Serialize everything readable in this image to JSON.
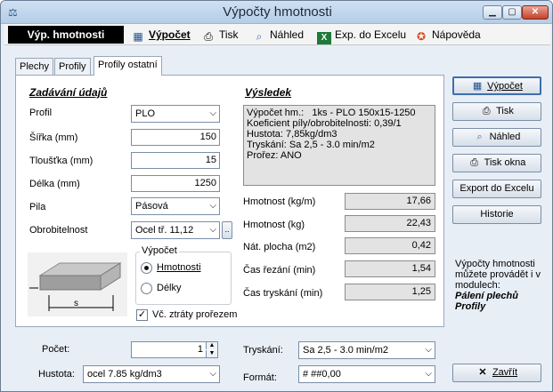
{
  "window": {
    "title": "Výpočty hmotnosti"
  },
  "menu": {
    "active": "Výp. hmotnosti",
    "items": [
      {
        "label": "Výpočet",
        "icon": "calculator-icon"
      },
      {
        "label": "Tisk",
        "icon": "printer-icon"
      },
      {
        "label": "Náhled",
        "icon": "preview-icon"
      },
      {
        "label": "Exp. do Excelu",
        "icon": "excel-icon"
      },
      {
        "label": "Nápověda",
        "icon": "help-lifebuoy-icon"
      }
    ]
  },
  "tabs": [
    "Plechy",
    "Profily",
    "Profily ostatní"
  ],
  "input_section": {
    "title": "Zadávání údajů",
    "profil_label": "Profil",
    "profil_value": "PLO",
    "sirka_label": "Šířka (mm)",
    "sirka_value": "150",
    "tloustka_label": "Tloušťka (mm)",
    "tloustka_value": "15",
    "delka_label": "Délka (mm)",
    "delka_value": "1250",
    "pila_label": "Pila",
    "pila_value": "Pásová",
    "obrobitelnost_label": "Obrobitelnost",
    "obrobitelnost_value": "Ocel tř. 11,12",
    "obrobitelnost_btn": "..",
    "diagram_label": "s",
    "vypocet_group": "Výpočet",
    "radio_hmotnosti": "Hmotnosti",
    "radio_delky": "Délky",
    "check_ztraty": "Vč. ztráty prořezem"
  },
  "result_section": {
    "title": "Výsledek",
    "text_lines": [
      "Výpočet hm.:   1ks - PLO 150x15-1250",
      "Koeficient píly/obrobitelnosti: 0,39/1",
      "Hustota: 7,85kg/dm3",
      "Tryskání: Sa 2,5 - 3.0 min/m2",
      "Prořez: ANO"
    ],
    "rows": [
      {
        "label": "Hmotnost (kg/m)",
        "value": "17,66"
      },
      {
        "label": "Hmotnost (kg)",
        "value": "22,43"
      },
      {
        "label": "Nát. plocha (m2)",
        "value": "0,42"
      },
      {
        "label": "Čas řezání (min)",
        "value": "1,54"
      },
      {
        "label": "Čas tryskání (min)",
        "value": "1,25"
      }
    ]
  },
  "buttons": {
    "vypocet": "Výpočet",
    "tisk": "Tisk",
    "nahled": "Náhled",
    "tisk_okna": "Tisk okna",
    "export": "Export do Excelu",
    "historie": "Historie",
    "zavrit": "Zavřít"
  },
  "note": {
    "text": "Výpočty hmotnosti můžete provádět i v modulech:",
    "module1": "Pálení plechů",
    "module2": "Profily"
  },
  "bottom": {
    "pocet_label": "Počet:",
    "pocet_value": "1",
    "hustota_label": "Hustota:",
    "hustota_value": "ocel 7.85 kg/dm3",
    "tryskani_label": "Tryskání:",
    "tryskani_value": "Sa 2,5 - 3.0 min/m2",
    "format_label": "Formát:",
    "format_value": "# ##0,00"
  }
}
